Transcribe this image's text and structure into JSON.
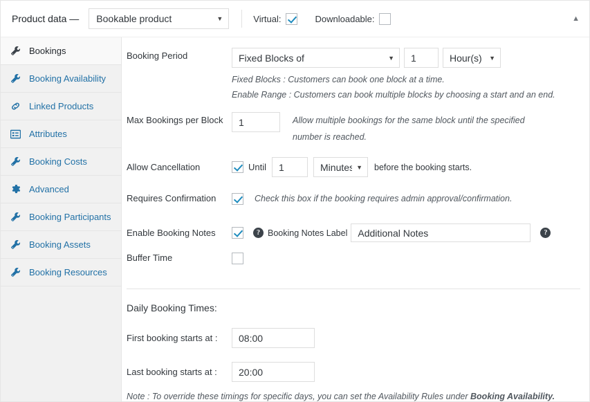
{
  "header": {
    "title": "Product data —",
    "product_type": "Bookable product",
    "virtual_label": "Virtual:",
    "virtual_checked": true,
    "downloadable_label": "Downloadable:",
    "downloadable_checked": false,
    "collapse_icon": "▲"
  },
  "sidebar": {
    "items": [
      {
        "label": "Bookings",
        "icon": "wrench-icon",
        "active": true
      },
      {
        "label": "Booking Availability",
        "icon": "wrench-icon",
        "active": false
      },
      {
        "label": "Linked Products",
        "icon": "link-icon",
        "active": false
      },
      {
        "label": "Attributes",
        "icon": "list-box-icon",
        "active": false
      },
      {
        "label": "Booking Costs",
        "icon": "wrench-icon",
        "active": false
      },
      {
        "label": "Advanced",
        "icon": "gear-icon",
        "active": false
      },
      {
        "label": "Booking Participants",
        "icon": "wrench-icon",
        "active": false
      },
      {
        "label": "Booking Assets",
        "icon": "wrench-icon",
        "active": false
      },
      {
        "label": "Booking Resources",
        "icon": "wrench-icon",
        "active": false
      }
    ]
  },
  "main": {
    "booking_period": {
      "label": "Booking Period",
      "type_value": "Fixed Blocks of",
      "amount_value": "1",
      "unit_value": "Hour(s)",
      "desc_1": "Fixed Blocks : Customers can book one block at a time.",
      "desc_2": "Enable Range : Customers can book multiple blocks by choosing a start and an end."
    },
    "max_bookings": {
      "label": "Max Bookings per Block",
      "value": "1",
      "desc": "Allow multiple bookings for the same block until the specified number is reached."
    },
    "allow_cancellation": {
      "label": "Allow Cancellation",
      "checked": true,
      "until_label": "Until",
      "amount_value": "1",
      "unit_value": "Minutes(s)",
      "suffix": "before the booking starts."
    },
    "requires_confirmation": {
      "label": "Requires Confirmation",
      "checked": true,
      "desc": "Check this box if the booking requires admin approval/confirmation."
    },
    "booking_notes": {
      "label": "Enable Booking Notes",
      "checked": true,
      "notes_label": "Booking Notes Label",
      "notes_value": "Additional Notes",
      "help_glyph": "?"
    },
    "buffer_time": {
      "label": "Buffer Time",
      "checked": false
    },
    "daily_booking_times": {
      "title": "Daily Booking Times:",
      "first_label": "First booking starts at :",
      "first_value": "08:00",
      "last_label": "Last booking starts at :",
      "last_value": "20:00",
      "note_prefix": "Note : To override these timings for specific days, you can set the Availability Rules under ",
      "note_bold": "Booking Availability."
    }
  },
  "colors": {
    "accent": "#2271a6",
    "checkbox": "#1e8cbe",
    "sidebar_bg": "#f1f1f1",
    "border": "#e5e5e5"
  }
}
